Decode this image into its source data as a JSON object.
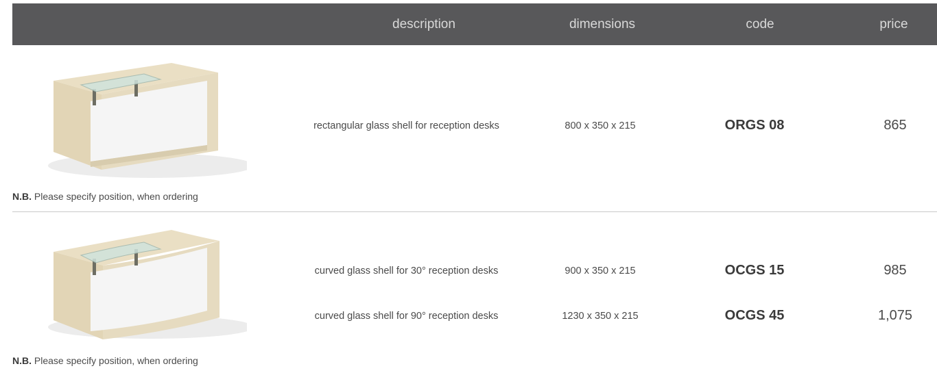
{
  "header": {
    "description": "description",
    "dimensions": "dimensions",
    "code": "code",
    "price": "price"
  },
  "groups": [
    {
      "image": "rectangular reception desk with glass shell",
      "note_bold": "N.B.",
      "note_text": "Please specify position, when ordering",
      "rows": [
        {
          "description": "rectangular glass shell for reception desks",
          "dimensions": "800 x 350 x 215",
          "code": "ORGS 08",
          "price": "865"
        }
      ]
    },
    {
      "image": "curved reception desk with glass shell",
      "note_bold": "N.B.",
      "note_text": "Please specify position, when ordering",
      "rows": [
        {
          "description": "curved glass shell for 30° reception desks",
          "dimensions": "900 x 350 x 215",
          "code": "OCGS 15",
          "price": "985"
        },
        {
          "description": "curved glass shell for 90° reception desks",
          "dimensions": "1230 x 350 x 215",
          "code": "OCGS 45",
          "price": "1,075"
        }
      ]
    }
  ],
  "colors": {
    "header_bg": "#58585a",
    "header_text": "#d9d9d9",
    "desk_wood": "#e8dcc0",
    "desk_panel": "#f4f4f4"
  }
}
